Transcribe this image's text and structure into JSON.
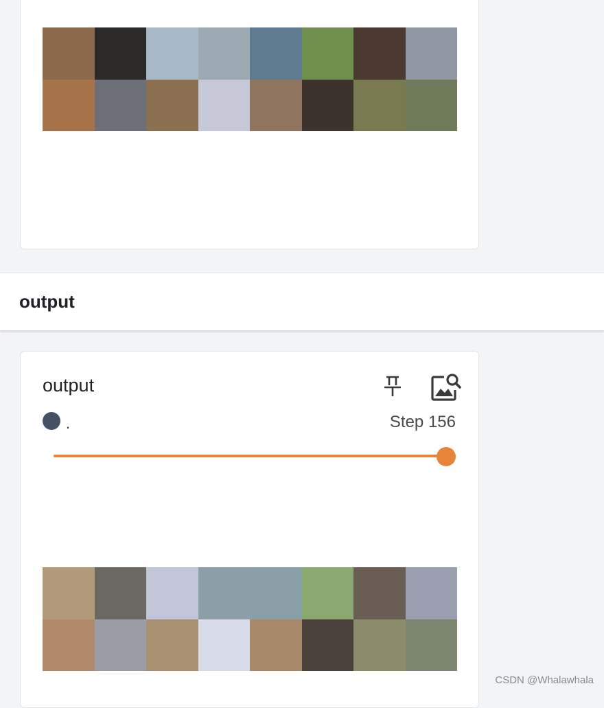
{
  "top_card": {
    "image_grid": {
      "rows": 2,
      "cols": 8,
      "colors": [
        "#8a6a4a",
        "#2c2a28",
        "#a9b8c6",
        "#9aaab0",
        "#5e7b90",
        "#6f8f4e",
        "#4a3a30",
        "#8f96a4",
        "#a6724a",
        "#6d6f78",
        "#8a7050",
        "#c6c8d8",
        "#8f7560",
        "#3c342c",
        "#7a7a50",
        "#6f7a5a"
      ]
    }
  },
  "section": {
    "title": "output"
  },
  "bottom_card": {
    "title": "output",
    "pin_icon": "pin-icon",
    "image_search_icon": "image-search-icon",
    "run_label": ".",
    "run_color": "#445268",
    "step_text": "Step 156",
    "slider_color": "#e8833a",
    "slider_value": 1.0,
    "image_grid": {
      "rows": 2,
      "cols": 8,
      "colors": [
        "#b09a7a",
        "#6a6860",
        "#c0c6d8",
        "#8c9ea6",
        "#8aa0a8",
        "#8aa870",
        "#6a5e54",
        "#9aa0b0",
        "#b08a6a",
        "#9a9ca6",
        "#a89070",
        "#d8dbe8",
        "#a88a6a",
        "#4a423a",
        "#8c8c6a",
        "#7c8670"
      ]
    }
  },
  "watermark": "CSDN @Whalawhala"
}
